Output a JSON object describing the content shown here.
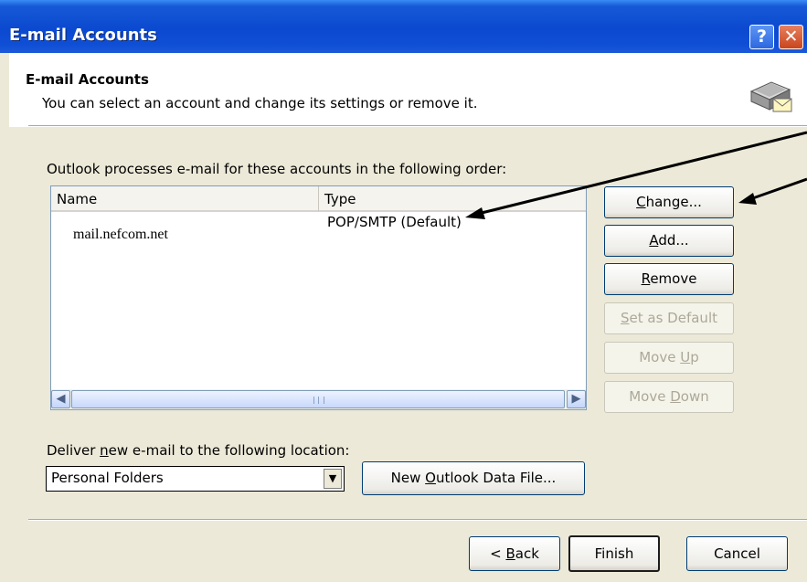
{
  "window": {
    "title": "E-mail Accounts",
    "help_glyph": "?",
    "close_glyph": "✕"
  },
  "header": {
    "title": "E-mail Accounts",
    "subtitle": "You can select an account and change its settings or remove it."
  },
  "accounts": {
    "intro": "Outlook processes e-mail for these accounts in the following order:",
    "columns": [
      "Name",
      "Type"
    ],
    "rows": [
      {
        "name": "mail.nefcom.net",
        "type": "POP/SMTP (Default)"
      }
    ]
  },
  "side_buttons": {
    "change": {
      "pre": "",
      "key": "C",
      "post": "hange..."
    },
    "add": {
      "pre": "",
      "key": "A",
      "post": "dd..."
    },
    "remove": {
      "pre": "",
      "key": "R",
      "post": "emove"
    },
    "set_default": {
      "pre": "",
      "key": "S",
      "post": "et as Default"
    },
    "move_up": {
      "pre": "Move ",
      "key": "U",
      "post": "p"
    },
    "move_down": {
      "pre": "Move ",
      "key": "D",
      "post": "own"
    }
  },
  "deliver": {
    "label_pre": "Deliver ",
    "label_key": "n",
    "label_post": "ew e-mail to the following location:",
    "selected": "Personal Folders",
    "new_file_pre": "New ",
    "new_file_key": "O",
    "new_file_post": "utlook Data File..."
  },
  "footer": {
    "back_pre": "< ",
    "back_key": "B",
    "back_post": "ack",
    "finish": "Finish",
    "cancel": "Cancel"
  },
  "icons": {
    "scroll_left": "◀",
    "scroll_right": "▶",
    "dropdown": "▼"
  }
}
